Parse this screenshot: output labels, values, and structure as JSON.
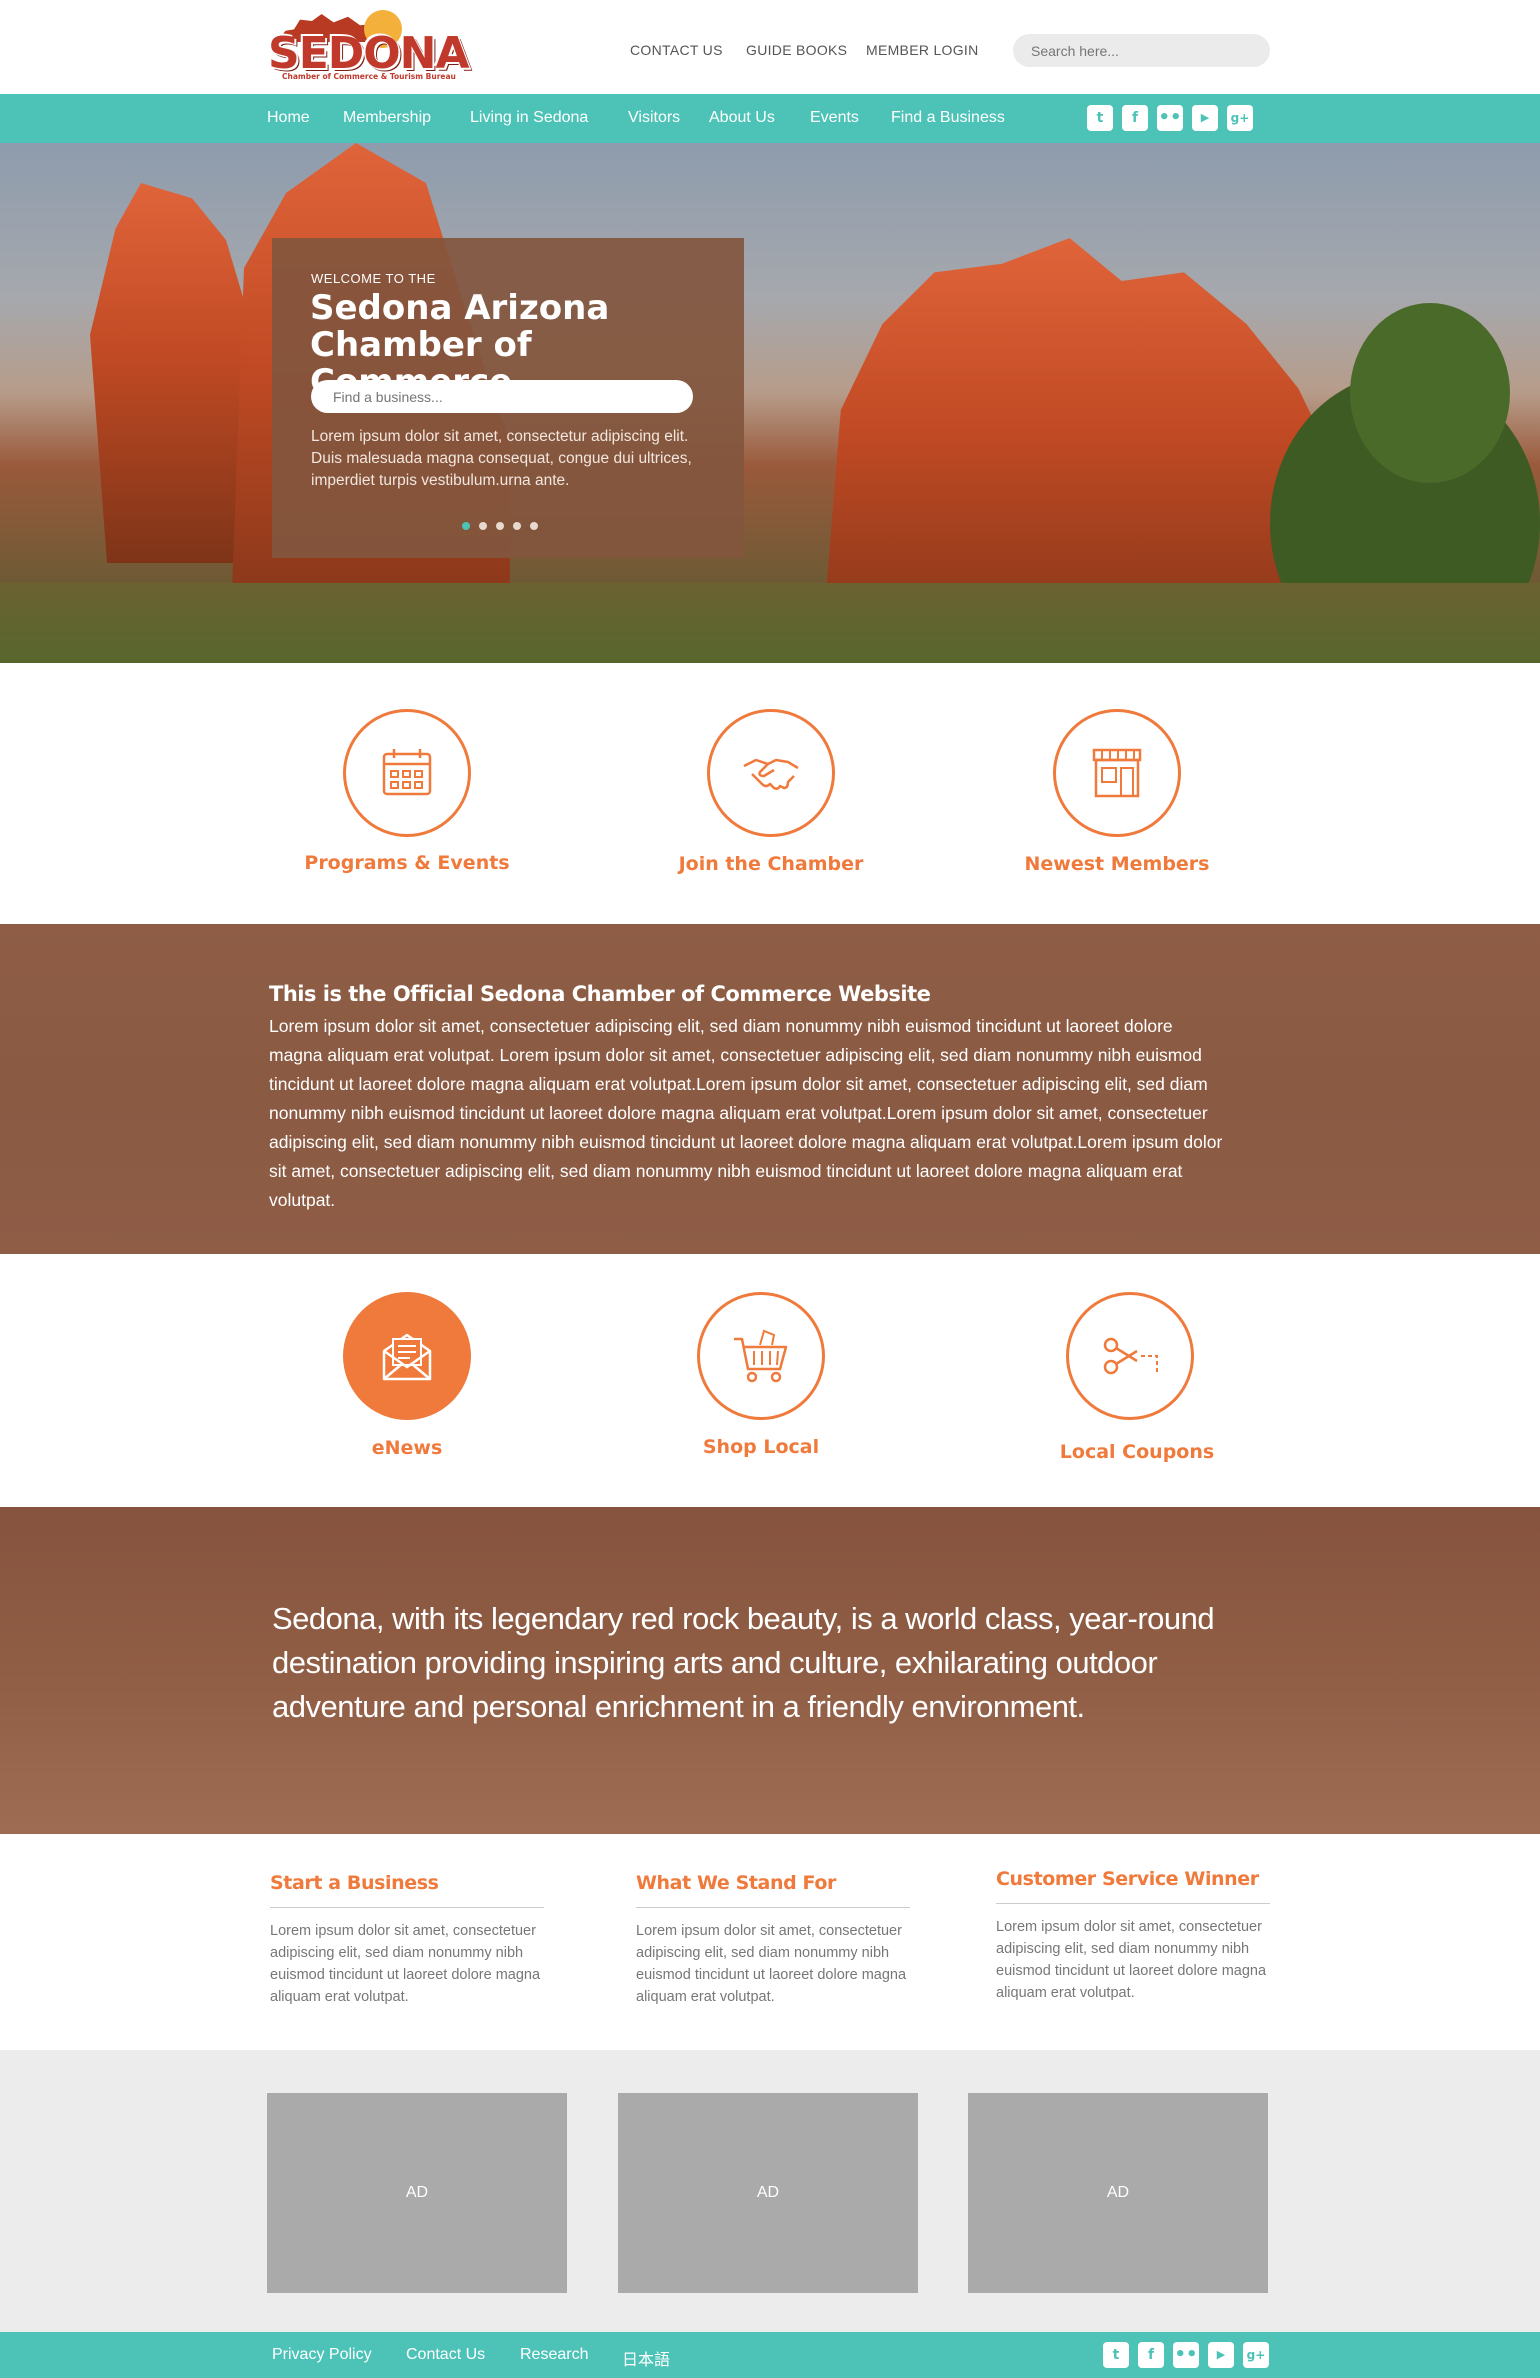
{
  "header": {
    "logo_text": "SEDONA",
    "logo_subtitle": "Chamber of Commerce & Tourism Bureau",
    "links": [
      "CONTACT US",
      "GUIDE BOOKS",
      "MEMBER LOGIN"
    ],
    "search_placeholder": "Search here..."
  },
  "nav": {
    "items": [
      "Home",
      "Membership",
      "Living in Sedona",
      "Visitors",
      "About Us",
      "Events",
      "Find a Business"
    ],
    "social": [
      "twitter-icon",
      "facebook-icon",
      "flickr-icon",
      "youtube-icon",
      "google-plus-icon"
    ]
  },
  "hero": {
    "welcome": "WELCOME TO THE",
    "title": "Sedona Arizona Chamber of Commerce",
    "search_placeholder": "Find a business...",
    "text": "Lorem ipsum dolor sit amet, consectetur adipiscing elit. Duis malesuada magna consequat, congue dui ultrices, imperdiet turpis vestibulum.urna ante.",
    "slides": 5,
    "active_slide": 1
  },
  "features_row1": [
    {
      "label": "Programs & Events",
      "icon": "calendar-icon"
    },
    {
      "label": "Join the Chamber",
      "icon": "handshake-icon"
    },
    {
      "label": "Newest Members",
      "icon": "storefront-icon"
    }
  ],
  "about": {
    "title": "This is the Official Sedona Chamber of Commerce Website",
    "text": "Lorem ipsum dolor sit amet, consectetuer adipiscing elit, sed diam nonummy nibh euismod tincidunt ut laoreet dolore magna aliquam erat volutpat. Lorem ipsum dolor sit amet, consectetuer adipiscing elit, sed diam nonummy nibh euismod tincidunt ut laoreet dolore magna aliquam erat volutpat.Lorem ipsum dolor sit amet, consectetuer adipiscing elit, sed diam nonummy nibh euismod tincidunt ut laoreet dolore magna aliquam erat volutpat.Lorem ipsum dolor sit amet, consectetuer adipiscing elit, sed diam nonummy nibh euismod tincidunt ut laoreet dolore magna aliquam erat volutpat.Lorem ipsum dolor sit amet, consectetuer adipiscing elit, sed diam nonummy nibh euismod tincidunt ut laoreet dolore magna aliquam erat volutpat."
  },
  "features_row2": [
    {
      "label": "eNews",
      "icon": "envelope-icon"
    },
    {
      "label": "Shop Local",
      "icon": "shopping-cart-icon"
    },
    {
      "label": "Local Coupons",
      "icon": "scissors-icon"
    }
  ],
  "tagline": "Sedona, with its legendary red rock beauty, is a world class, year-round destination providing inspiring arts and culture, exhilarating outdoor adventure and personal enrichment in a friendly environment.",
  "columns": [
    {
      "title": "Start a Business",
      "text": "Lorem ipsum dolor sit amet, consectetuer adipiscing elit, sed diam nonummy nibh euismod tincidunt ut laoreet dolore magna aliquam erat volutpat."
    },
    {
      "title": "What We Stand For",
      "text": "Lorem ipsum dolor sit amet, consectetuer adipiscing elit, sed diam nonummy nibh euismod tincidunt ut laoreet dolore magna aliquam erat volutpat."
    },
    {
      "title": "Customer Service Winner",
      "text": "Lorem ipsum dolor sit amet, consectetuer adipiscing elit, sed diam nonummy nibh euismod tincidunt ut laoreet dolore magna aliquam erat volutpat."
    }
  ],
  "ads": [
    "AD",
    "AD",
    "AD"
  ],
  "footer": {
    "links": [
      "Privacy Policy",
      "Contact Us",
      "Research",
      "日本語"
    ],
    "social": [
      "twitter-icon",
      "facebook-icon",
      "flickr-icon",
      "youtube-icon",
      "google-plus-icon"
    ]
  },
  "colors": {
    "accent": "#ef7a3b",
    "teal": "#4dc3b8",
    "brown": "#8f5d45"
  }
}
